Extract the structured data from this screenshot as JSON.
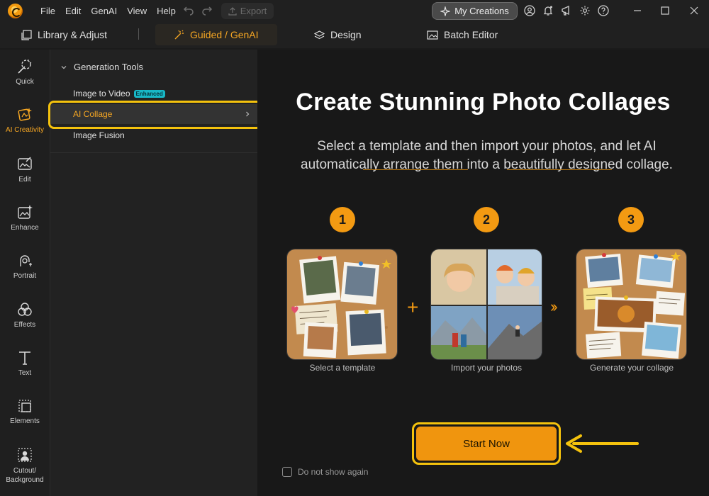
{
  "menu": [
    "File",
    "Edit",
    "GenAI",
    "View",
    "Help"
  ],
  "toolbar": {
    "export_label": "Export",
    "my_creations_label": "My Creations"
  },
  "modules": {
    "library": "Library & Adjust",
    "guided": "Guided / GenAI",
    "design": "Design",
    "batch": "Batch Editor"
  },
  "rail": [
    {
      "label": "Quick"
    },
    {
      "label": "AI Creativity"
    },
    {
      "label": "Edit"
    },
    {
      "label": "Enhance"
    },
    {
      "label": "Portrait"
    },
    {
      "label": "Effects"
    },
    {
      "label": "Text"
    },
    {
      "label": "Elements"
    },
    {
      "label": "Cutout/\nBackground"
    }
  ],
  "panel": {
    "section": "Generation Tools",
    "tools": [
      {
        "label": "Image to Video",
        "badge": "Enhanced"
      },
      {
        "label": "AI Collage"
      },
      {
        "label": "Image Fusion"
      }
    ]
  },
  "main": {
    "title": "Create Stunning Photo Collages",
    "subtitle": "Select a template and then import your photos, and let AI automatically arrange them into a beautifully designed collage.",
    "steps": [
      {
        "num": "1",
        "label": "Select a template"
      },
      {
        "num": "2",
        "label": "Import your photos"
      },
      {
        "num": "3",
        "label": "Generate your collage"
      }
    ],
    "start_label": "Start Now",
    "dont_show_label": "Do not show again"
  },
  "colors": {
    "accent": "#f39a12",
    "highlight": "#f4c20d",
    "badge": "#18b7c6"
  }
}
